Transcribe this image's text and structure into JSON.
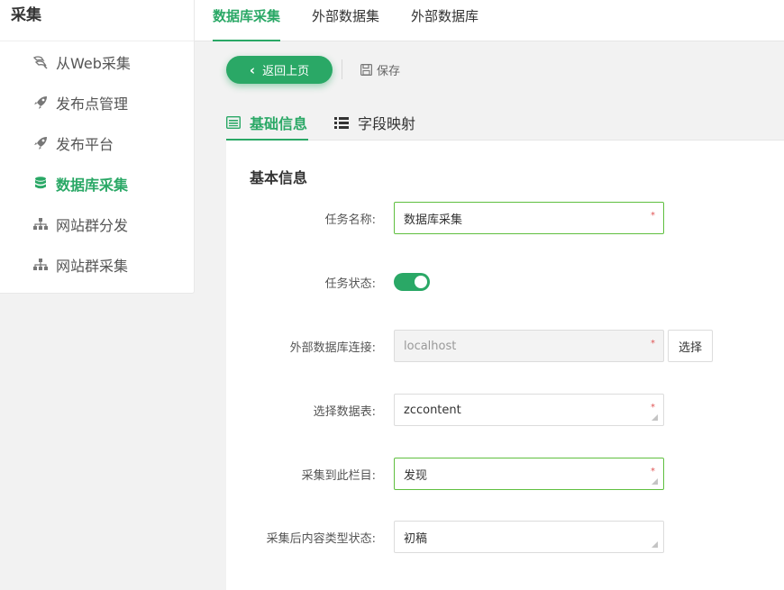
{
  "sidebar": {
    "title": "采集",
    "items": [
      {
        "label": "从Web采集",
        "icon": "web-crawl-icon"
      },
      {
        "label": "发布点管理",
        "icon": "rocket-icon"
      },
      {
        "label": "发布平台",
        "icon": "rocket-icon"
      },
      {
        "label": "数据库采集",
        "icon": "database-icon",
        "active": true
      },
      {
        "label": "网站群分发",
        "icon": "sitemap-icon"
      },
      {
        "label": "网站群采集",
        "icon": "sitemap-icon"
      }
    ]
  },
  "top_tabs": [
    {
      "label": "数据库采集",
      "active": true
    },
    {
      "label": "外部数据集"
    },
    {
      "label": "外部数据库"
    }
  ],
  "toolbar": {
    "back_label": "返回上页",
    "save_label": "保存"
  },
  "sub_tabs": [
    {
      "label": "基础信息",
      "icon": "list-alt-icon",
      "active": true
    },
    {
      "label": "字段映射",
      "icon": "list-icon"
    }
  ],
  "form": {
    "section_title": "基本信息",
    "fields": {
      "task_name": {
        "label": "任务名称:",
        "value": "数据库采集",
        "required_mark": "*"
      },
      "task_status": {
        "label": "任务状态:",
        "enabled": true
      },
      "db_connection": {
        "label": "外部数据库连接:",
        "value": "localhost",
        "required_mark": "*",
        "button_label": "选择"
      },
      "db_table": {
        "label": "选择数据表:",
        "value": "zccontent",
        "required_mark": "*"
      },
      "target_catalog": {
        "label": "采集到此栏目:",
        "value": "发现",
        "required_mark": "*"
      },
      "content_status": {
        "label": "采集后内容类型状态:",
        "value": "初稿"
      }
    }
  },
  "colors": {
    "accent": "#2aa866",
    "focus_border": "#5fbf3f",
    "required": "#e05555"
  }
}
